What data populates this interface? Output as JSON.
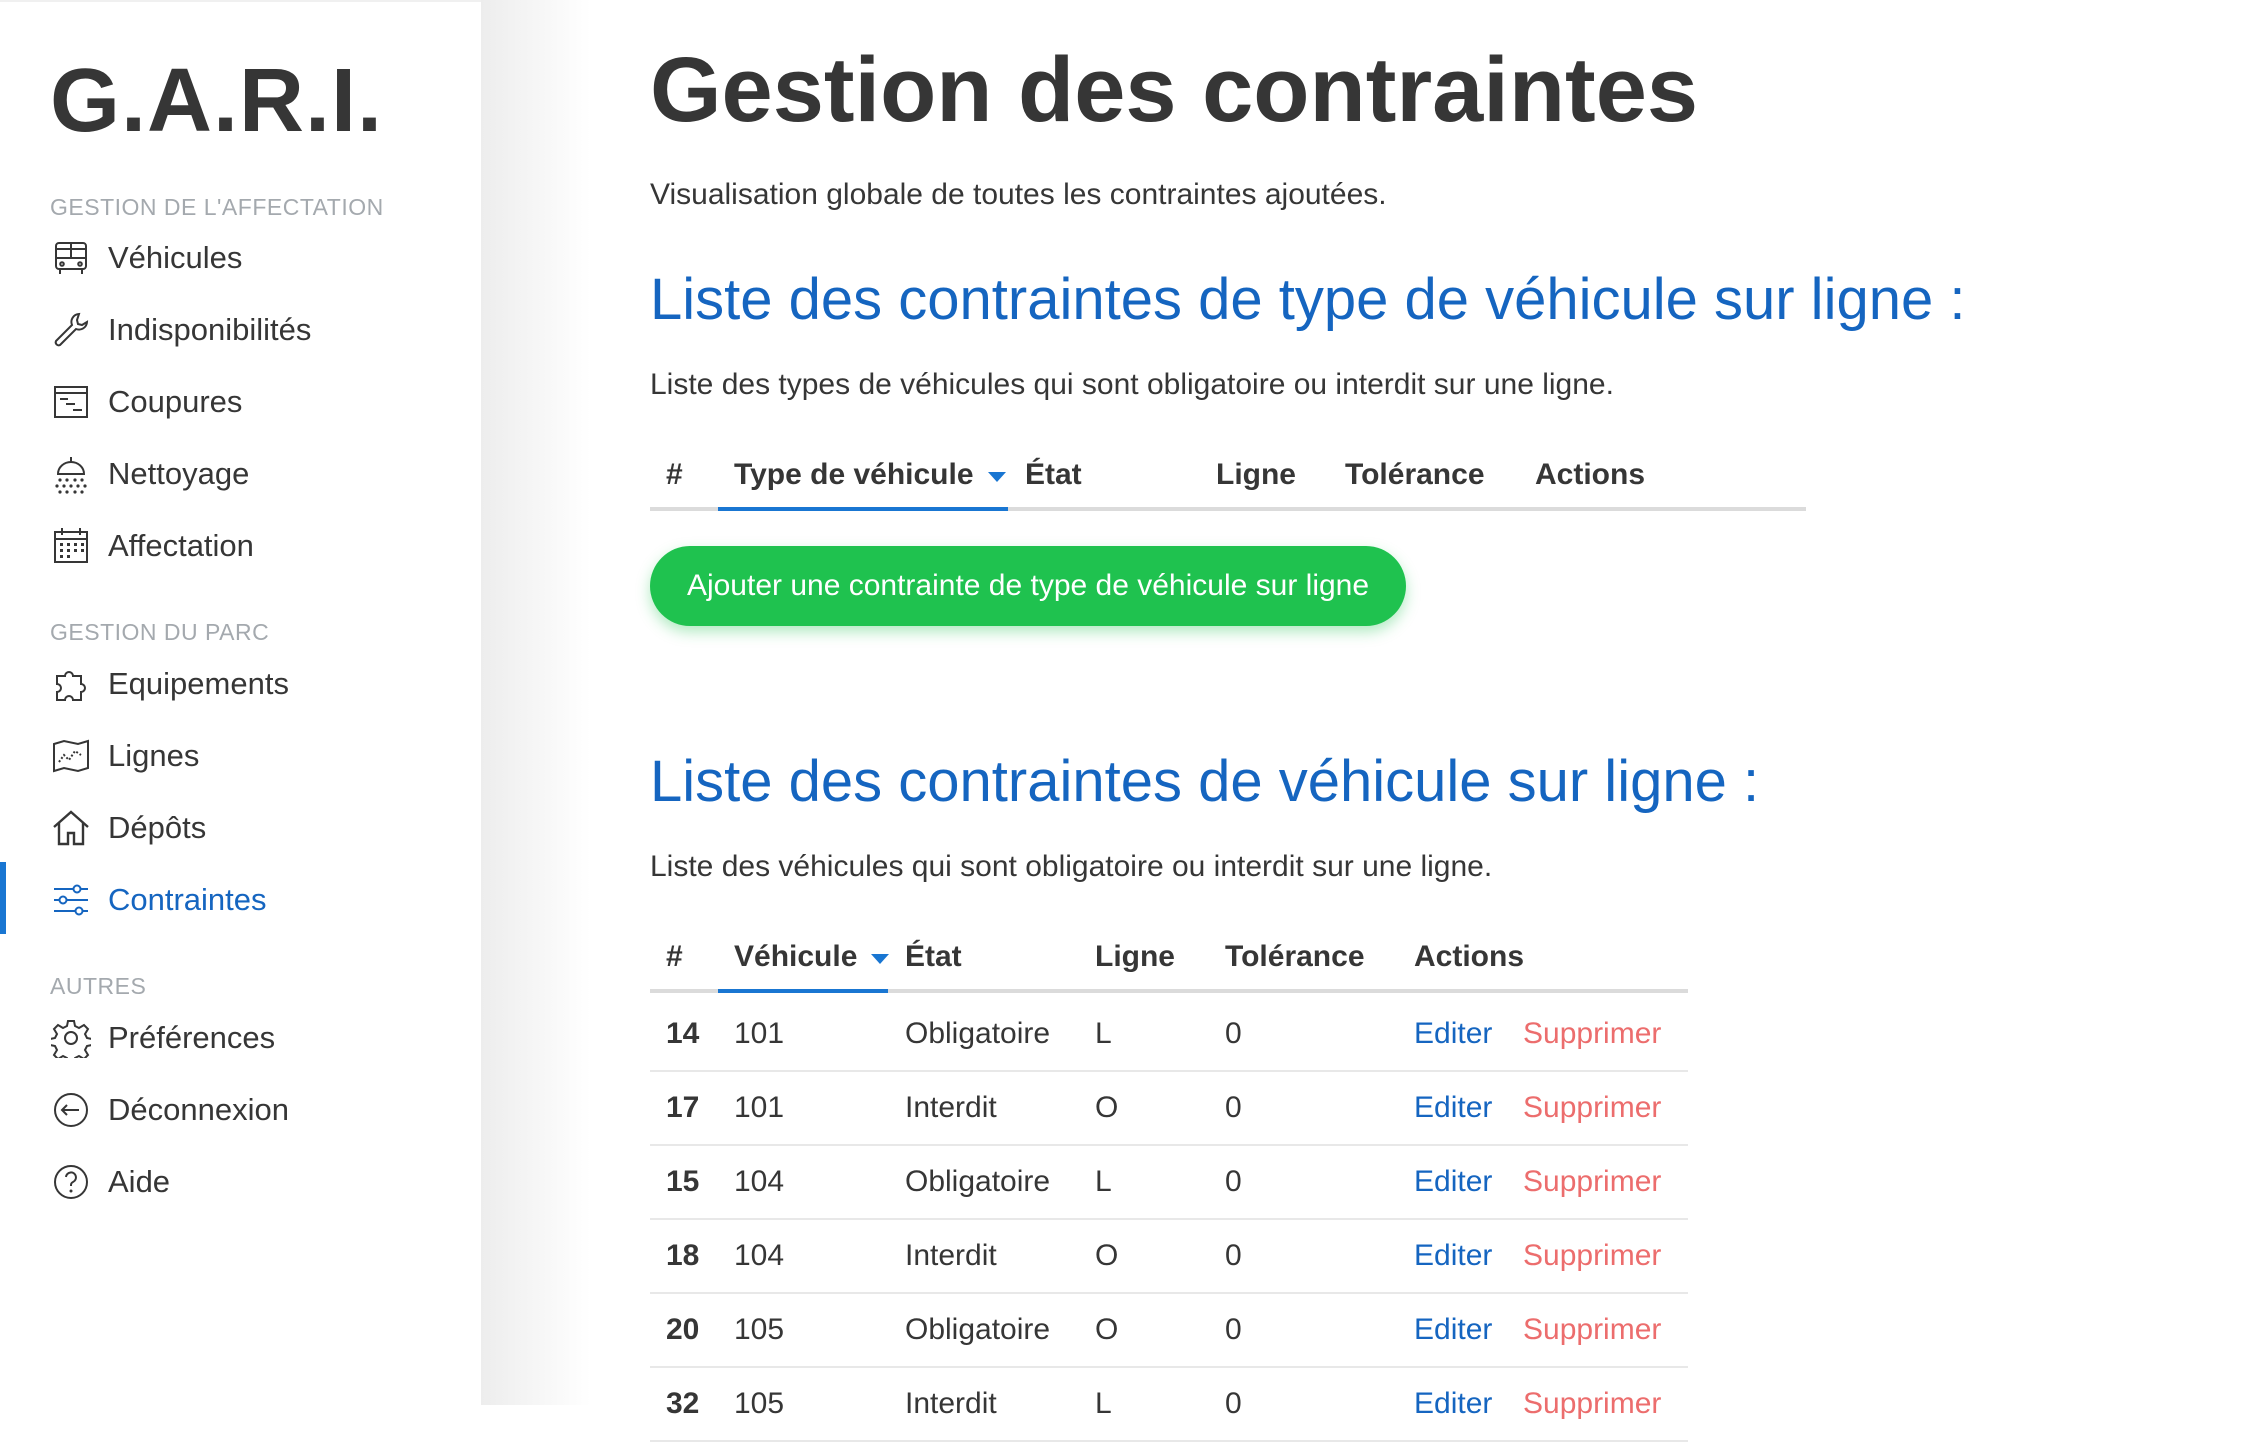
{
  "app": {
    "brand": "G.A.R.I."
  },
  "sidebar": {
    "sections": [
      {
        "label": "GESTION DE L'AFFECTATION"
      },
      {
        "label": "GESTION DU PARC"
      },
      {
        "label": "AUTRES"
      }
    ],
    "items": [
      {
        "label": "Véhicules",
        "icon": "bus-icon"
      },
      {
        "label": "Indisponibilités",
        "icon": "wrench-icon"
      },
      {
        "label": "Coupures",
        "icon": "schedule-icon"
      },
      {
        "label": "Nettoyage",
        "icon": "shower-icon"
      },
      {
        "label": "Affectation",
        "icon": "calendar-icon"
      },
      {
        "label": "Equipements",
        "icon": "puzzle-icon"
      },
      {
        "label": "Lignes",
        "icon": "map-icon"
      },
      {
        "label": "Dépôts",
        "icon": "home-icon"
      },
      {
        "label": "Contraintes",
        "icon": "sliders-icon",
        "active": true
      },
      {
        "label": "Préférences",
        "icon": "gear-icon"
      },
      {
        "label": "Déconnexion",
        "icon": "logout-icon"
      },
      {
        "label": "Aide",
        "icon": "help-icon"
      }
    ],
    "active_color": "#1565c0"
  },
  "main": {
    "title": "Gestion des contraintes",
    "subtitle": "Visualisation globale de toutes les contraintes ajoutées.",
    "type_section": {
      "title": "Liste des contraintes de type de véhicule sur ligne :",
      "description": "Liste des types de véhicules qui sont obligatoire ou interdit sur une ligne.",
      "columns": [
        "#",
        "Type de véhicule",
        "État",
        "Ligne",
        "Tolérance",
        "Actions"
      ],
      "add_button": "Ajouter une contrainte de type de véhicule sur ligne"
    },
    "vehicle_section": {
      "title": "Liste des contraintes de véhicule sur ligne :",
      "description": "Liste des véhicules qui sont obligatoire ou interdit sur une ligne.",
      "columns": [
        "#",
        "Véhicule",
        "État",
        "Ligne",
        "Tolérance",
        "Actions"
      ],
      "rows": [
        {
          "id": "14",
          "vehicle": "101",
          "state": "Obligatoire",
          "line": "L",
          "tolerance": "0",
          "edit": "Editer",
          "delete": "Supprimer"
        },
        {
          "id": "17",
          "vehicle": "101",
          "state": "Interdit",
          "line": "O",
          "tolerance": "0",
          "edit": "Editer",
          "delete": "Supprimer"
        },
        {
          "id": "15",
          "vehicle": "104",
          "state": "Obligatoire",
          "line": "L",
          "tolerance": "0",
          "edit": "Editer",
          "delete": "Supprimer"
        },
        {
          "id": "18",
          "vehicle": "104",
          "state": "Interdit",
          "line": "O",
          "tolerance": "0",
          "edit": "Editer",
          "delete": "Supprimer"
        },
        {
          "id": "20",
          "vehicle": "105",
          "state": "Obligatoire",
          "line": "O",
          "tolerance": "0",
          "edit": "Editer",
          "delete": "Supprimer"
        },
        {
          "id": "32",
          "vehicle": "105",
          "state": "Interdit",
          "line": "L",
          "tolerance": "0",
          "edit": "Editer",
          "delete": "Supprimer"
        }
      ]
    },
    "colors": {
      "primary": "#1565c0",
      "add_button": "#1fc24f",
      "delete": "#ec6d6d"
    }
  }
}
